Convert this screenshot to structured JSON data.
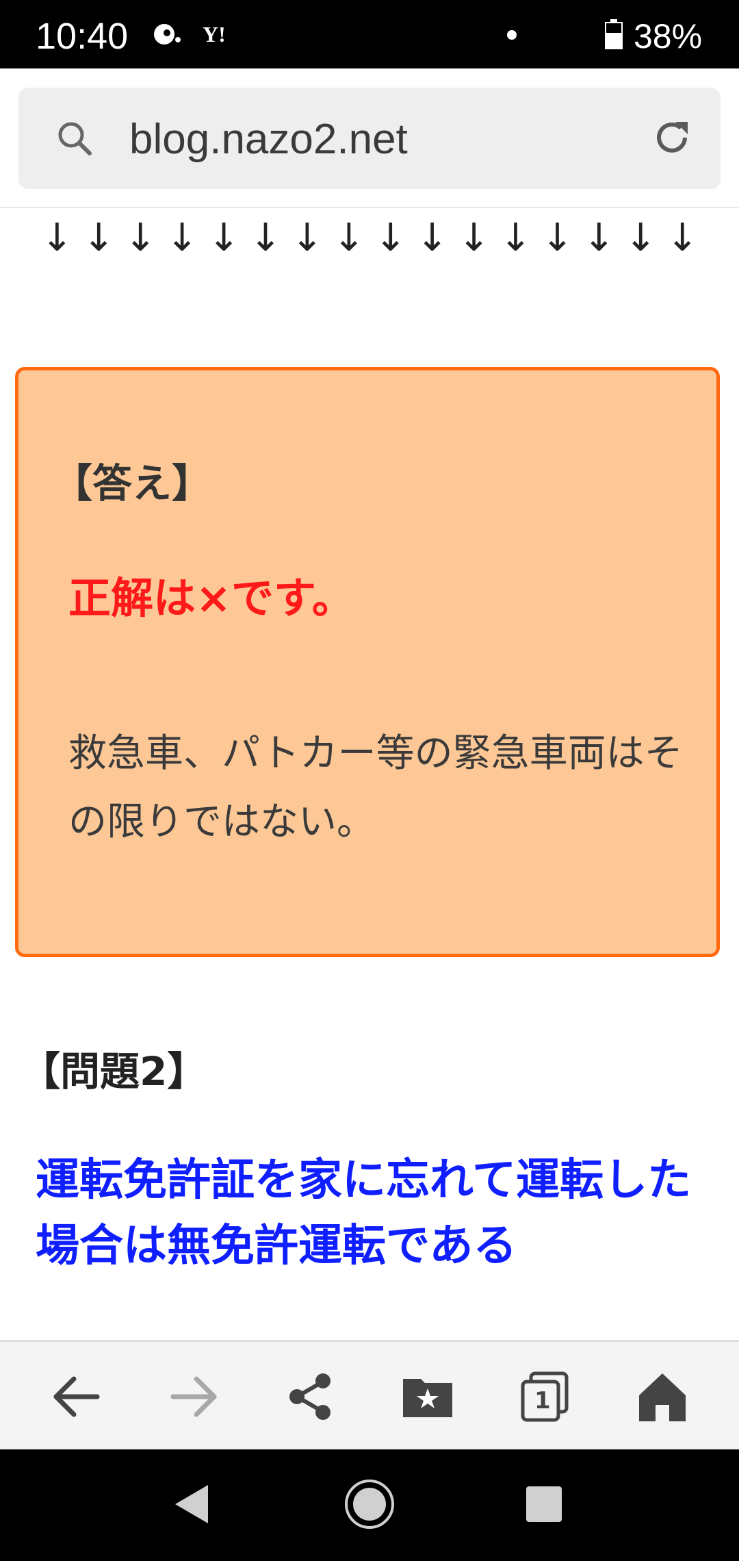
{
  "status_bar": {
    "time": "10:40",
    "battery": "38%",
    "yahoo_label": "Y!"
  },
  "browser": {
    "url": "blog.nazo2.net"
  },
  "content": {
    "arrows": "↓↓↓↓↓↓↓↓↓↓↓↓↓↓↓↓",
    "answer": {
      "heading": "【答え】",
      "correct": "正解は×です。",
      "body": "救急車、パトカー等の緊急車両はその限りではない。"
    },
    "question": {
      "heading": "【問題2】",
      "text": "運転免許証を家に忘れて運転した場合は無免許運転である"
    }
  },
  "toolbar": {
    "tab_count": "1"
  },
  "colors": {
    "answer_bg": "#fdc896",
    "answer_border": "#ff6a10",
    "correct": "#ff1a1a",
    "question": "#0f1fff"
  },
  "icons": [
    "search-icon",
    "reload-icon",
    "back-icon",
    "forward-icon",
    "share-icon",
    "bookmarks-icon",
    "tabs-icon",
    "home-icon",
    "nav-back-icon",
    "nav-home-icon",
    "nav-recents-icon"
  ]
}
